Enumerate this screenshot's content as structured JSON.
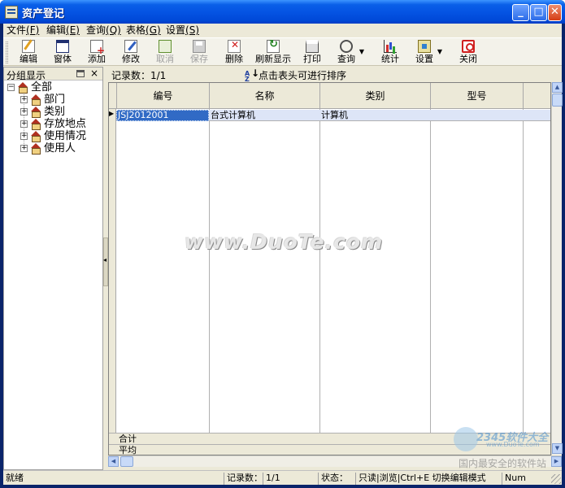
{
  "window": {
    "title": "资产登记"
  },
  "menu": [
    {
      "label": "文件",
      "key": "(F)"
    },
    {
      "label": "编辑",
      "key": "(E)"
    },
    {
      "label": "查询",
      "key": "(Q)"
    },
    {
      "label": "表格",
      "key": "(G)"
    },
    {
      "label": "设置",
      "key": "(S)"
    }
  ],
  "toolbar": {
    "edit": "编辑",
    "window": "窗体",
    "add": "添加",
    "modify": "修改",
    "cancel": "取消",
    "save": "保存",
    "delete": "删除",
    "refresh": "刷新显示",
    "print": "打印",
    "query": "查询",
    "stats": "统计",
    "settings": "设置",
    "close": "关闭"
  },
  "left_panel": {
    "title": "分组显示",
    "close": "×",
    "root": {
      "expander": "−",
      "label": "全部"
    },
    "children": [
      {
        "expander": "+",
        "label": "部门"
      },
      {
        "expander": "+",
        "label": "类别"
      },
      {
        "expander": "+",
        "label": "存放地点"
      },
      {
        "expander": "+",
        "label": "使用情况"
      },
      {
        "expander": "+",
        "label": "使用人"
      }
    ]
  },
  "grid": {
    "record_count": "记录数：1/1",
    "sort_hint": "点击表头可进行排序",
    "sort_icon_text": "A Z",
    "columns": [
      "编号",
      "名称",
      "类别",
      "型号"
    ],
    "rows": [
      [
        "JSJ2012001",
        "台式计算机",
        "计算机",
        ""
      ]
    ],
    "footer": [
      "合计",
      "平均"
    ]
  },
  "status": {
    "ready": "就绪",
    "record_label": "记录数：",
    "record_value": "1/1",
    "state_label": "状态：",
    "state_value": "只读|浏览|Ctrl+E 切换编辑模式",
    "num": "Num"
  },
  "watermark": {
    "text": "www.DuoTe.com",
    "logo_num": "2345软件大全",
    "logo_url": "www.DuoTe.com",
    "slogan": "国内最安全的软件站"
  }
}
